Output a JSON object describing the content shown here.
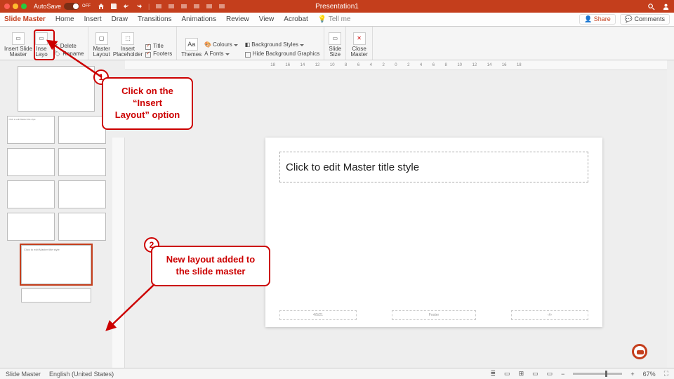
{
  "titlebar": {
    "autosave_label": "AutoSave",
    "autosave_state": "OFF",
    "document_title": "Presentation1"
  },
  "tabs": {
    "items": [
      "Slide Master",
      "Home",
      "Insert",
      "Draw",
      "Transitions",
      "Animations",
      "Review",
      "View",
      "Acrobat"
    ],
    "active": "Slide Master",
    "tell_me": "Tell me",
    "share": "Share",
    "comments": "Comments"
  },
  "ribbon": {
    "insert_slide_master": "Insert Slide\nMaster",
    "insert_layout": "Inse\nLayo",
    "insert_layout_full": "Insert Layout",
    "delete": "Delete",
    "rename": "Rename",
    "master_layout": "Master\nLayout",
    "insert_placeholder": "Insert\nPlaceholder",
    "title_chk": "Title",
    "footers_chk": "Footers",
    "themes": "Themes",
    "colours": "Colours",
    "fonts": "Fonts",
    "bg_styles": "Background Styles",
    "hide_bg": "Hide Background Graphics",
    "slide_size": "Slide\nSize",
    "close_master": "Close\nMaster"
  },
  "ruler": {
    "ticks": [
      "18",
      "16",
      "14",
      "12",
      "10",
      "8",
      "6",
      "4",
      "2",
      "0",
      "2",
      "4",
      "6",
      "8",
      "10",
      "12",
      "14",
      "16",
      "18"
    ]
  },
  "canvas": {
    "title_placeholder": "Click to edit Master title style",
    "date": "4/5/21",
    "footer": "Footer",
    "num": "‹#›"
  },
  "status": {
    "mode": "Slide Master",
    "lang": "English (United States)",
    "zoom": "67%"
  },
  "annot": {
    "step1_badge": "1",
    "step1_text": "Click on the\n“Insert\nLayout” option",
    "step2_badge": "2",
    "step2_text": "New layout added to\nthe slide master"
  },
  "thumb_text": {
    "t1": "Click to edit Master title style",
    "t7": "Click to edit Master title style"
  }
}
